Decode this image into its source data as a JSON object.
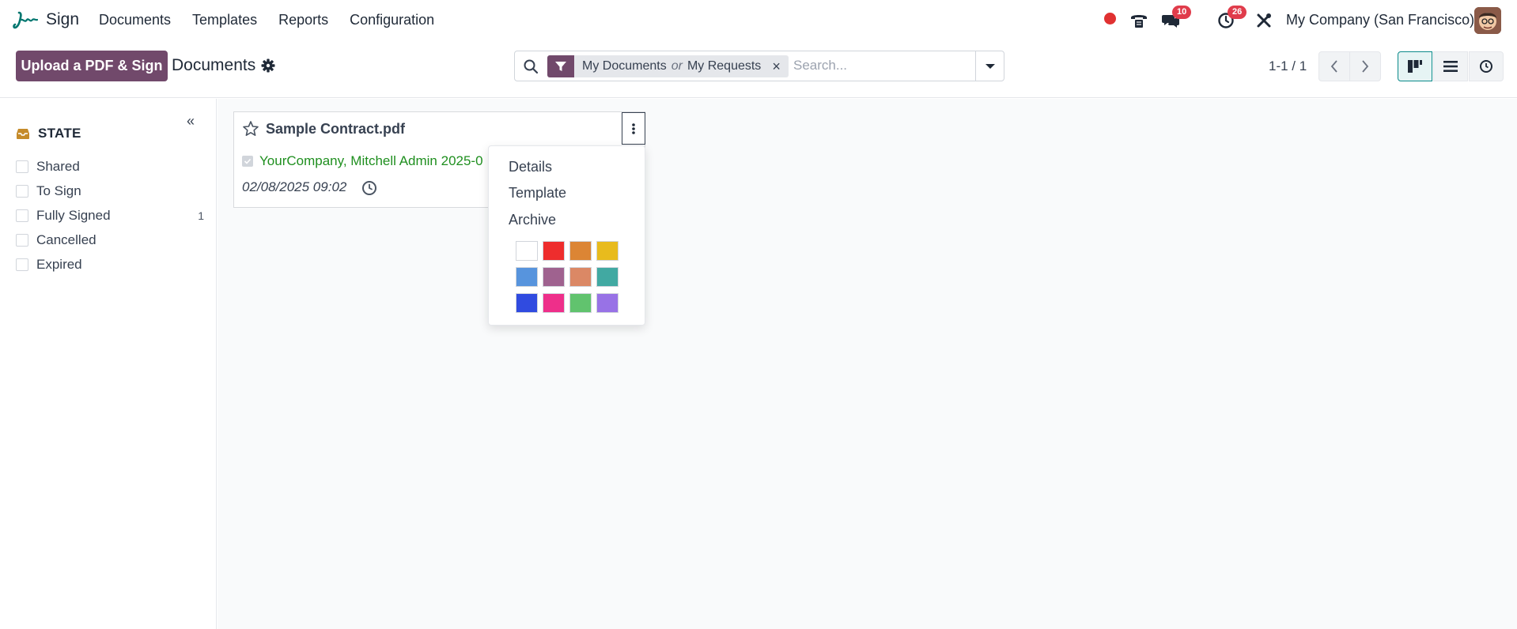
{
  "app": {
    "name": "Sign"
  },
  "nav": {
    "items": [
      "Documents",
      "Templates",
      "Reports",
      "Configuration"
    ]
  },
  "systray": {
    "messages_badge": "10",
    "activities_badge": "26",
    "company": "My Company (San Francisco)",
    "colors": {
      "recording": "#e03131",
      "badge": "#e03c4b"
    }
  },
  "control": {
    "upload_label": "Upload a PDF & Sign",
    "breadcrumb": "Documents",
    "facet": {
      "value_1": "My Documents",
      "separator": "or",
      "value_2": "My Requests",
      "remove": "×"
    },
    "search_placeholder": "Search...",
    "pager": "1-1 / 1",
    "accent": "#71496b"
  },
  "sidebar": {
    "collapse": "«",
    "section_title": "STATE",
    "filters": [
      {
        "label": "Shared",
        "count": ""
      },
      {
        "label": "To Sign",
        "count": ""
      },
      {
        "label": "Fully Signed",
        "count": "1"
      },
      {
        "label": "Cancelled",
        "count": ""
      },
      {
        "label": "Expired",
        "count": ""
      }
    ]
  },
  "card": {
    "title": "Sample Contract.pdf",
    "signers": "YourCompany, Mitchell Admin 2025-0",
    "date": "02/08/2025 09:02",
    "signer_color": "#1f8f1f"
  },
  "dropdown": {
    "items": [
      "Details",
      "Template",
      "Archive"
    ],
    "colors": [
      "#ffffff",
      "#ee2d2d",
      "#dc8534",
      "#e8bb1d",
      "#5794dd",
      "#9f628f",
      "#db8865",
      "#41a9a2",
      "#304be0",
      "#ee2f8a",
      "#61c36e",
      "#9872e6"
    ]
  }
}
